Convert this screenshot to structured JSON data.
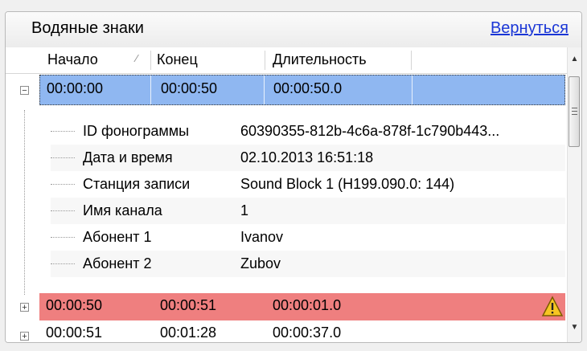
{
  "header": {
    "title": "Водяные знаки",
    "back_label": "Вернуться"
  },
  "columns": [
    "Начало",
    "Конец",
    "Длительность"
  ],
  "rows": [
    {
      "start": "00:00:00",
      "end": "00:00:50",
      "duration": "00:00:50.0",
      "state": "selected",
      "expanded": true
    },
    {
      "start": "00:00:50",
      "end": "00:00:51",
      "duration": "00:00:01.0",
      "state": "warning",
      "expanded": false
    },
    {
      "start": "00:00:51",
      "end": "00:01:28",
      "duration": "00:00:37.0",
      "state": "normal",
      "expanded": false
    }
  ],
  "details": [
    {
      "key": "ID фонограммы",
      "value": "60390355-812b-4c6a-878f-1c790b443..."
    },
    {
      "key": "Дата и время",
      "value": "02.10.2013 16:51:18"
    },
    {
      "key": "Станция записи",
      "value": "Sound Block 1 (H199.090.0: 144)"
    },
    {
      "key": "Имя канала",
      "value": "1"
    },
    {
      "key": "Абонент 1",
      "value": "Ivanov"
    },
    {
      "key": "Абонент 2",
      "value": "Zubov"
    }
  ],
  "colors": {
    "selected": "#8fb7f1",
    "warning": "#ef7f7f",
    "link": "#1a36d6"
  },
  "icons": {
    "expand": "plus-box-icon",
    "collapse": "minus-box-icon",
    "warning": "warning-triangle-icon",
    "sort": "sort-indicator-icon"
  }
}
